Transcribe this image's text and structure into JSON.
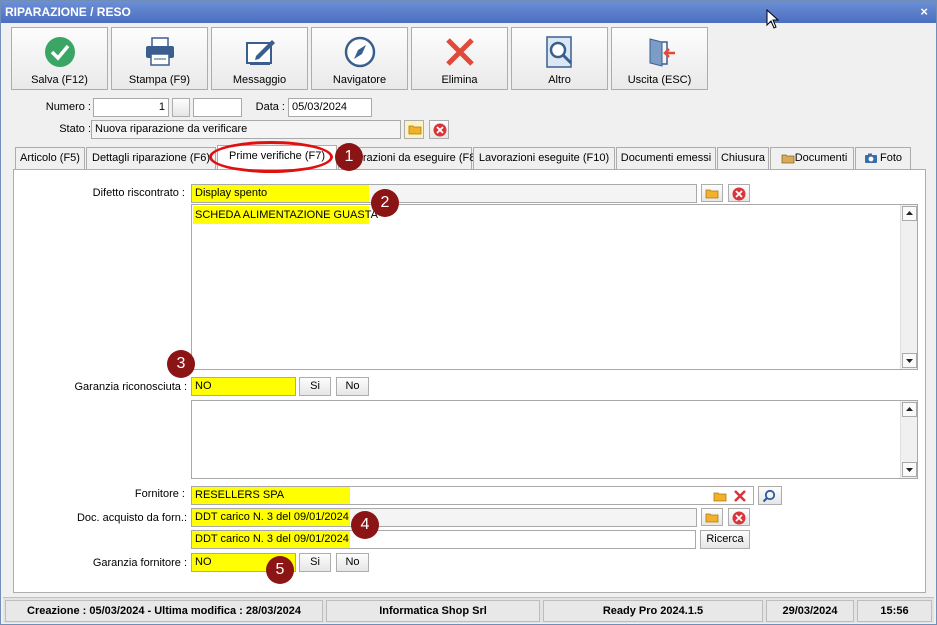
{
  "window": {
    "title": "RIPARAZIONE / RESO",
    "close_glyph": "×"
  },
  "toolbar": {
    "buttons": [
      {
        "label": "Salva (F12)",
        "icon": "check-icon"
      },
      {
        "label": "Stampa (F9)",
        "icon": "printer-icon"
      },
      {
        "label": "Messaggio",
        "icon": "message-edit-icon"
      },
      {
        "label": "Navigatore",
        "icon": "compass-icon"
      },
      {
        "label": "Elimina",
        "icon": "delete-x-icon"
      },
      {
        "label": "Altro",
        "icon": "search-document-icon"
      },
      {
        "label": "Uscita (ESC)",
        "icon": "exit-door-icon"
      }
    ]
  },
  "header": {
    "numero_label": "Numero :",
    "numero_value": "1",
    "numero_suffix": "",
    "data_label": "Data :",
    "data_value": "05/03/2024",
    "stato_label": "Stato :",
    "stato_value": "Nuova riparazione da verificare"
  },
  "tabs": [
    {
      "label": "Articolo (F5)"
    },
    {
      "label": "Dettagli riparazione (F6)"
    },
    {
      "label": "Prime verifiche (F7)"
    },
    {
      "label": "Lavorazioni da eseguire (F8)"
    },
    {
      "label": "Lavorazioni eseguite  (F10)"
    },
    {
      "label": "Documenti emessi"
    },
    {
      "label": "Chiusura"
    },
    {
      "label": "Documenti"
    },
    {
      "label": "Foto"
    }
  ],
  "form": {
    "difetto_label": "Difetto riscontrato :",
    "difetto_value": "Display spento",
    "difetto_note": "SCHEDA ALIMENTAZIONE GUASTA",
    "garanzia_label": "Garanzia riconosciuta :",
    "garanzia_value": "NO",
    "si_label": "Si",
    "no_label": "No",
    "fornitore_label": "Fornitore :",
    "fornitore_value": "RESELLERS SPA",
    "doc_label": "Doc. acquisto da forn.:",
    "doc_value": "DDT carico N. 3 del 09/01/2024",
    "doc_value2": "DDT carico N. 3 del 09/01/2024",
    "ricerca_label": "Ricerca",
    "garanzia_forn_label": "Garanzia fornitore :",
    "garanzia_forn_value": "NO"
  },
  "badges": [
    "1",
    "2",
    "3",
    "4",
    "5"
  ],
  "status": {
    "creation": "Creazione : 05/03/2024 - Ultima modifica : 28/03/2024",
    "company": "Informatica Shop Srl",
    "app": "Ready Pro 2024.1.5",
    "date": "29/03/2024",
    "time": "15:56"
  },
  "colors": {
    "highlight": "#ffff00",
    "badge": "#8b1414",
    "ring": "#e01010",
    "title": "#4a6fc0"
  }
}
